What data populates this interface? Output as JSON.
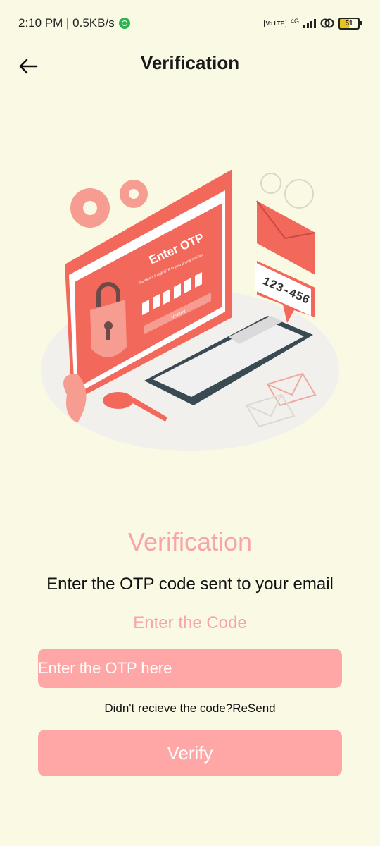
{
  "status_bar": {
    "time_speed": "2:10 PM | 0.5KB/s",
    "network": "4G",
    "lte_label": "Vo LTE",
    "battery": "51"
  },
  "header": {
    "title": "Verification",
    "back_icon": "arrow-left-icon"
  },
  "illustration": {
    "window_title": "Enter OTP",
    "window_text": "We sent a 6 digit OTP to your phone number",
    "window_button": "VERIFY",
    "bubble_code": "123-456"
  },
  "content": {
    "heading": "Verification",
    "subtitle": "Enter the OTP code sent to your email",
    "code_label": "Enter the Code",
    "otp_placeholder": "Enter the OTP here",
    "resend_prompt": "Didn't recieve the code?",
    "resend_link": "ReSend",
    "verify_label": "Verify"
  },
  "colors": {
    "background": "#FAF9E3",
    "accent": "#FFA6A6",
    "accent_text": "#F7A5A5",
    "illustration_red": "#F2685A"
  }
}
